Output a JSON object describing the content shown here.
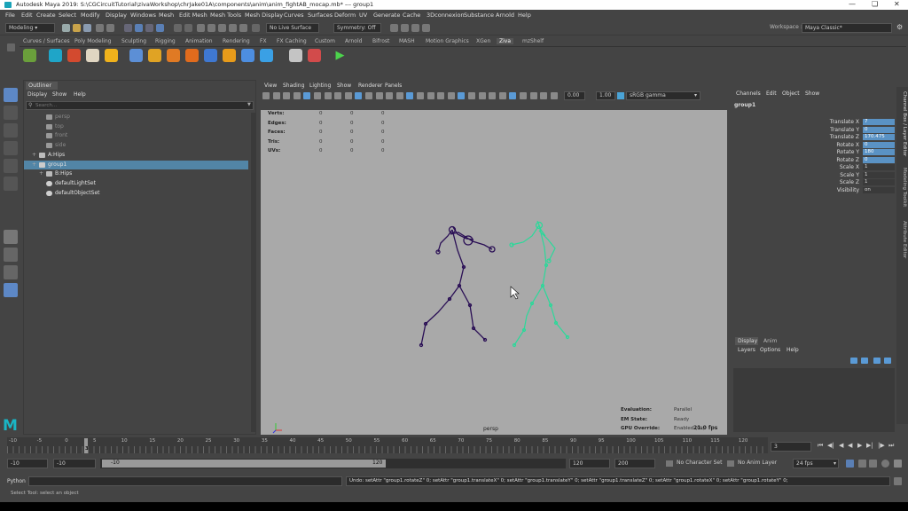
{
  "window": {
    "title": "Autodesk Maya 2019: S:\\CGCircuitTutorial\\zivaWorkshop\\chrJake01A\\components\\anim\\anim_fightAB_mocap.mb* --- group1"
  },
  "menubar": {
    "items": [
      "File",
      "Edit",
      "Create",
      "Select",
      "Modify",
      "Display",
      "Windows",
      "Mesh",
      "Edit Mesh",
      "Mesh Tools",
      "Mesh Display",
      "Curves",
      "Surfaces",
      "Deform",
      "UV",
      "Generate",
      "Cache",
      "3Dconnexion",
      "Substance",
      "Arnold",
      "Help"
    ]
  },
  "status_line": {
    "mode": "Modeling",
    "live_surface": "No Live Surface",
    "symmetry": "Symmetry: Off",
    "workspace_label": "Workspace :",
    "workspace": "Maya Classic*"
  },
  "shelf": {
    "tabs": [
      "Curves / Surfaces",
      "Poly Modeling",
      "Sculpting",
      "Rigging",
      "Animation",
      "Rendering",
      "FX",
      "FX Caching",
      "Custom",
      "Arnold",
      "Bifrost",
      "MASH",
      "Motion Graphics",
      "XGen",
      "Ziva",
      "mzShelf"
    ],
    "active_tab": "Ziva"
  },
  "outliner": {
    "title": "Outliner",
    "menus": [
      "Display",
      "Show",
      "Help"
    ],
    "search_placeholder": "Search...",
    "items": [
      {
        "label": "persp",
        "dim": true
      },
      {
        "label": "top",
        "dim": true
      },
      {
        "label": "front",
        "dim": true
      },
      {
        "label": "side",
        "dim": true
      },
      {
        "label": "A:Hips",
        "dim": false
      },
      {
        "label": "group1",
        "dim": false,
        "selected": true
      },
      {
        "label": "B:Hips",
        "dim": false
      },
      {
        "label": "defaultLightSet",
        "dim": false
      },
      {
        "label": "defaultObjectSet",
        "dim": false
      }
    ]
  },
  "viewport": {
    "menus": [
      "View",
      "Shading",
      "Lighting",
      "Show",
      "Renderer",
      "Panels"
    ],
    "exposure": "0.00",
    "gamma": "1.00",
    "color_space": "sRGB gamma",
    "hud_stats": [
      {
        "label": "Verts:",
        "values": [
          "0",
          "0",
          "0"
        ]
      },
      {
        "label": "Edges:",
        "values": [
          "0",
          "0",
          "0"
        ]
      },
      {
        "label": "Faces:",
        "values": [
          "0",
          "0",
          "0"
        ]
      },
      {
        "label": "Tris:",
        "values": [
          "0",
          "0",
          "0"
        ]
      },
      {
        "label": "UVs:",
        "values": [
          "0",
          "0",
          "0"
        ]
      }
    ],
    "hud_eval": [
      {
        "label": "Evaluation:",
        "value": "Parallel"
      },
      {
        "label": "EM State:",
        "value": "Ready"
      },
      {
        "label": "GPU Override:",
        "value": "Enabled (0k)"
      }
    ],
    "fps": "21.0 fps",
    "camera": "persp",
    "skeleton_a_color": "#2a0f55",
    "skeleton_b_color": "#2bd99a"
  },
  "channel_box": {
    "menus": [
      "Channels",
      "Edit",
      "Object",
      "Show"
    ],
    "object": "group1",
    "channels": [
      {
        "name": "Translate X",
        "value": "7",
        "highlight": true
      },
      {
        "name": "Translate Y",
        "value": "0",
        "highlight": true
      },
      {
        "name": "Translate Z",
        "value": "170.475",
        "highlight": true
      },
      {
        "name": "Rotate X",
        "value": "0",
        "highlight": true
      },
      {
        "name": "Rotate Y",
        "value": "180",
        "highlight": true
      },
      {
        "name": "Rotate Z",
        "value": "0",
        "highlight": true
      },
      {
        "name": "Scale X",
        "value": "1",
        "highlight": false
      },
      {
        "name": "Scale Y",
        "value": "1",
        "highlight": false
      },
      {
        "name": "Scale Z",
        "value": "1",
        "highlight": false
      },
      {
        "name": "Visibility",
        "value": "on",
        "highlight": false
      }
    ]
  },
  "layer_editor": {
    "tabs": [
      "Display",
      "Anim"
    ],
    "menus": [
      "Layers",
      "Options",
      "Help"
    ]
  },
  "side_tabs": [
    "Channel Box / Layer Editor",
    "Modeling Toolkit",
    "Attribute Editor"
  ],
  "timeline": {
    "ticks": [
      "-10",
      "-5",
      "0",
      "5",
      "10",
      "15",
      "20",
      "25",
      "30",
      "35",
      "40",
      "45",
      "50",
      "55",
      "60",
      "65",
      "70",
      "75",
      "80",
      "85",
      "90",
      "95",
      "100",
      "105",
      "110",
      "115",
      "120"
    ],
    "current_frame_marker": "3",
    "current_frame": "3"
  },
  "range": {
    "start": "-10",
    "playback_start": "-10",
    "slider_start": "-10",
    "slider_end": "120",
    "playback_end": "120",
    "end": "200",
    "character_set": "No Character Set",
    "anim_layer": "No Anim Layer",
    "fps": "24 fps"
  },
  "command": {
    "language": "Python",
    "result": "Undo: setAttr \"group1.rotateZ\" 0; setAttr \"group1.translateX\" 0; setAttr \"group1.translateY\" 0; setAttr \"group1.translateZ\" 0; setAttr \"group1.rotateX\" 0; setAttr \"group1.rotateY\" 0;"
  },
  "help_line": "Select Tool: select an object"
}
